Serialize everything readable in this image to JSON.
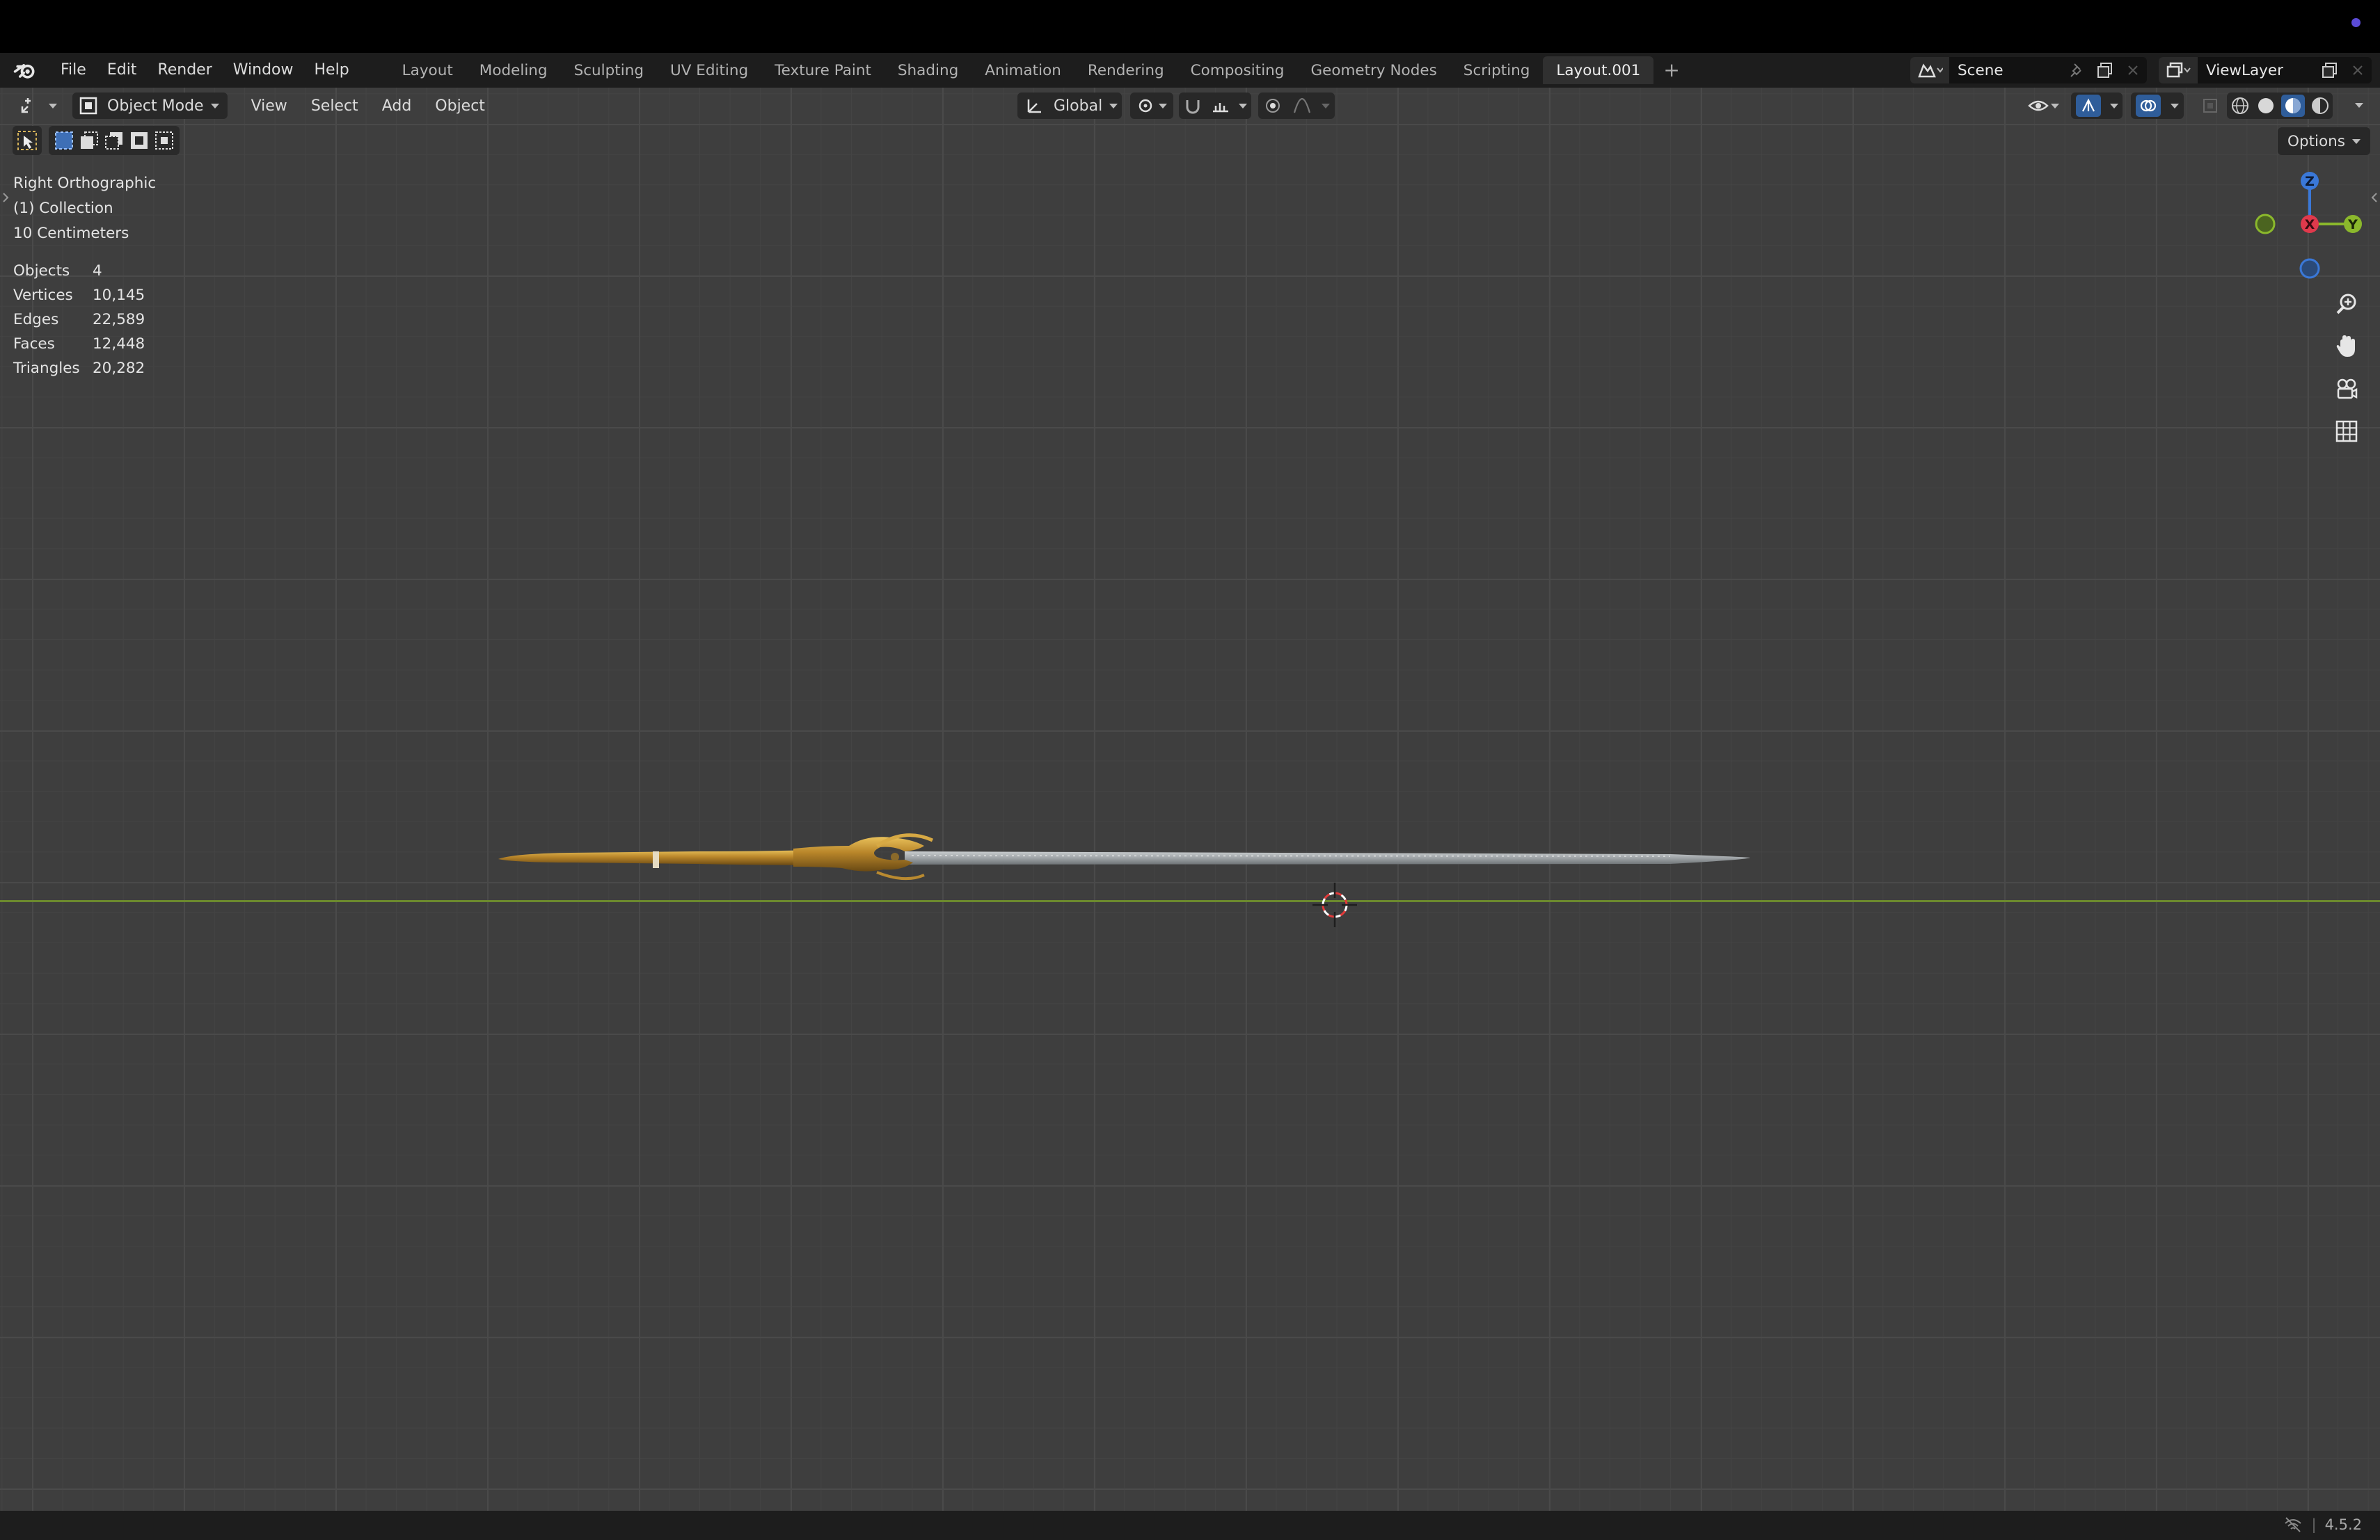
{
  "topbar": {
    "menus": [
      "File",
      "Edit",
      "Render",
      "Window",
      "Help"
    ],
    "workspaces": [
      "Layout",
      "Modeling",
      "Sculpting",
      "UV Editing",
      "Texture Paint",
      "Shading",
      "Animation",
      "Rendering",
      "Compositing",
      "Geometry Nodes",
      "Scripting",
      "Layout.001"
    ],
    "active_workspace": "Layout.001",
    "add_workspace": "+",
    "scene": "Scene",
    "view_layer": "ViewLayer"
  },
  "viewport_header": {
    "mode": "Object Mode",
    "menus": [
      "View",
      "Select",
      "Add",
      "Object"
    ],
    "transform_orientation": "Global",
    "options": "Options"
  },
  "overlay": {
    "view_name": "Right Orthographic",
    "collection": "(1) Collection",
    "scale": "10 Centimeters"
  },
  "stats": [
    {
      "label": "Objects",
      "value": "4"
    },
    {
      "label": "Vertices",
      "value": "10,145"
    },
    {
      "label": "Edges",
      "value": "22,589"
    },
    {
      "label": "Faces",
      "value": "12,448"
    },
    {
      "label": "Triangles",
      "value": "20,282"
    }
  ],
  "gizmo": {
    "z": "Z",
    "x": "X",
    "y": "Y"
  },
  "status": {
    "version": "4.5.2"
  },
  "colors": {
    "axis_x": "#e0394c",
    "axis_y": "#8bb82c",
    "axis_z": "#3a78d8",
    "horizon": "#6c8a2e",
    "gold": "#c8962f",
    "blade": "#a8acae"
  }
}
